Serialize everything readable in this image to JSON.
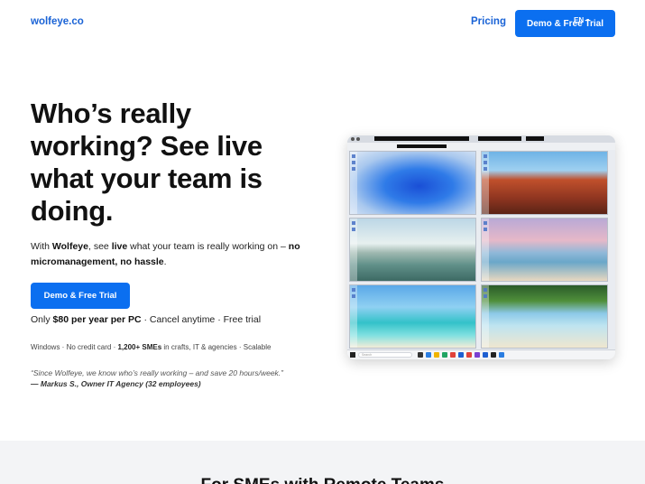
{
  "nav": {
    "logo": "wolfeye.co",
    "pricing": "Pricing",
    "cta": "Demo & Free Trial",
    "lang": "EN"
  },
  "hero": {
    "title": "Who’s really working? See live what your team is doing.",
    "sub_1": "With ",
    "sub_2": "Wolfeye",
    "sub_3": ", see ",
    "sub_4": "live",
    "sub_5": " what your team is really working on – ",
    "sub_6": "no micromanagement, no hassle",
    "sub_7": ".",
    "cta": "Demo & Free Trial",
    "price_1": "Only ",
    "price_2": "$80 per year per PC",
    "price_3": " · Cancel anytime · Free trial",
    "facts_1": "Windows · No credit card · ",
    "facts_2": "1,200+ SMEs",
    "facts_3": " in crafts, IT & agencies · Scalable",
    "quote": "“Since Wolfeye, we know who’s really working – and save 20 hours/week.”",
    "author": "— Markus S., Owner IT Agency (32 employees)"
  },
  "screenshot": {
    "taskbar_search": "Search",
    "tiles": [
      {
        "name": "windows-wallpaper-tile",
        "bg": "radial-gradient(ellipse at 55% 55%, #1a4fd6 0%, #2f7be8 35%, #a9c8ee 70%, #dfe9f6 100%)"
      },
      {
        "name": "boat-deck-tile",
        "bg": "linear-gradient(180deg, #6fb3e6 0%, #9fd0f0 30%, #c0502c 45%, #8e3520 75%, #5a2316 100%)"
      },
      {
        "name": "lake-sunrise-tile",
        "bg": "linear-gradient(180deg, #bcd7e6 0%, #e7f0ef 40%, #9fb8b0 55%, #5f8f88 75%, #3d6a64 100%)"
      },
      {
        "name": "beach-sunset-tile",
        "bg": "linear-gradient(180deg, #b9a9d6 0%, #e6b8c8 35%, #8fb8d8 55%, #6aa7c9 70%, #e8d8c0 100%)"
      },
      {
        "name": "tropical-lagoon-tile",
        "bg": "linear-gradient(180deg, #5aa8e8 0%, #8fd0f2 35%, #33c2c9 60%, #7fe0e0 80%, #f3ecd8 100%)"
      },
      {
        "name": "hammock-beach-tile",
        "bg": "linear-gradient(180deg, #2a5a2a 0%, #4f8f3a 25%, #8cc9e8 45%, #bfe4f0 65%, #efe6cf 100%)"
      }
    ]
  },
  "lower": {
    "title": "For SMEs with Remote Teams"
  }
}
